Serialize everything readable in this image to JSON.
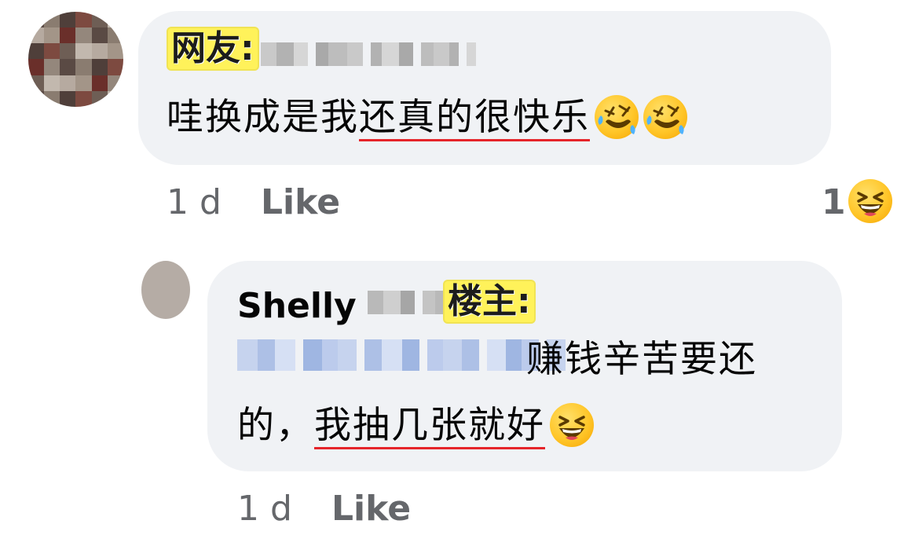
{
  "comment_1": {
    "label": "网友:",
    "text_plain": "哇换成是我",
    "text_underlined": "还真的很快乐",
    "emojis": [
      "rolling-on-floor-laughing-icon",
      "rolling-on-floor-laughing-icon"
    ],
    "time": "1 d",
    "like_label": "Like",
    "reaction_count": "1",
    "reaction_icon": "grinning-squinting-face-icon"
  },
  "comment_2": {
    "author": "Shelly",
    "label": "楼主:",
    "line_1_text": "赚钱辛苦要还",
    "line_2_plain": "的，",
    "line_2_underlined": "我抽几张就好",
    "emoji": "grinning-squinting-face-icon",
    "time": "1 d",
    "like_label": "Like"
  },
  "colors": {
    "bubble_bg": "#f0f2f5",
    "underline": "#e5242a",
    "tag_bg": "#fff25a",
    "meta_text": "#65676b"
  }
}
